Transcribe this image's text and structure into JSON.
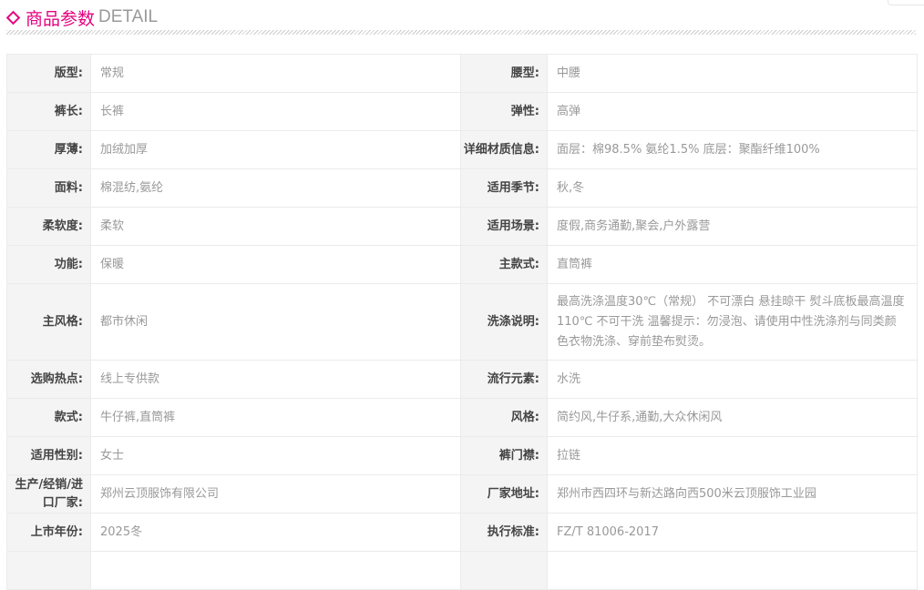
{
  "header": {
    "title": "商品参数",
    "title_en": "DETAIL"
  },
  "rows": [
    [
      {
        "k": "版型:",
        "v": "常规"
      },
      {
        "k": "腰型:",
        "v": "中腰"
      }
    ],
    [
      {
        "k": "裤长:",
        "v": "长裤"
      },
      {
        "k": "弹性:",
        "v": "高弹"
      }
    ],
    [
      {
        "k": "厚薄:",
        "v": "加绒加厚"
      },
      {
        "k": "详细材质信息:",
        "v": "面层：棉98.5% 氨纶1.5% 底层：聚酯纤维100%"
      }
    ],
    [
      {
        "k": "面料:",
        "v": "棉混纺,氨纶"
      },
      {
        "k": "适用季节:",
        "v": "秋,冬"
      }
    ],
    [
      {
        "k": "柔软度:",
        "v": "柔软"
      },
      {
        "k": "适用场景:",
        "v": "度假,商务通勤,聚会,户外露营"
      }
    ],
    [
      {
        "k": "功能:",
        "v": "保暖"
      },
      {
        "k": "主款式:",
        "v": "直筒裤"
      }
    ],
    [
      {
        "k": "主风格:",
        "v": "都市休闲"
      },
      {
        "k": "洗涤说明:",
        "v": "最高洗涤温度30℃（常规） 不可漂白 悬挂晾干 熨斗底板最高温度110℃ 不可干洗 温馨提示：勿浸泡、请使用中性洗涤剂与同类颜色衣物洗涤、穿前垫布熨烫。"
      }
    ],
    [
      {
        "k": "选购热点:",
        "v": "线上专供款"
      },
      {
        "k": "流行元素:",
        "v": "水洗"
      }
    ],
    [
      {
        "k": "款式:",
        "v": "牛仔裤,直筒裤"
      },
      {
        "k": "风格:",
        "v": "简约风,牛仔系,通勤,大众休闲风"
      }
    ],
    [
      {
        "k": "适用性别:",
        "v": "女士"
      },
      {
        "k": "裤门襟:",
        "v": "拉链"
      }
    ],
    [
      {
        "k": "生产/经销/进口厂家:",
        "v": "郑州云顶服饰有限公司"
      },
      {
        "k": "厂家地址:",
        "v": "郑州市西四环与新达路向西500米云顶服饰工业园"
      }
    ],
    [
      {
        "k": "上市年份:",
        "v": "2025冬"
      },
      {
        "k": "执行标准:",
        "v": "FZ/T 81006-2017"
      }
    ],
    [
      {
        "k": "",
        "v": ""
      },
      {
        "k": "",
        "v": ""
      }
    ]
  ]
}
